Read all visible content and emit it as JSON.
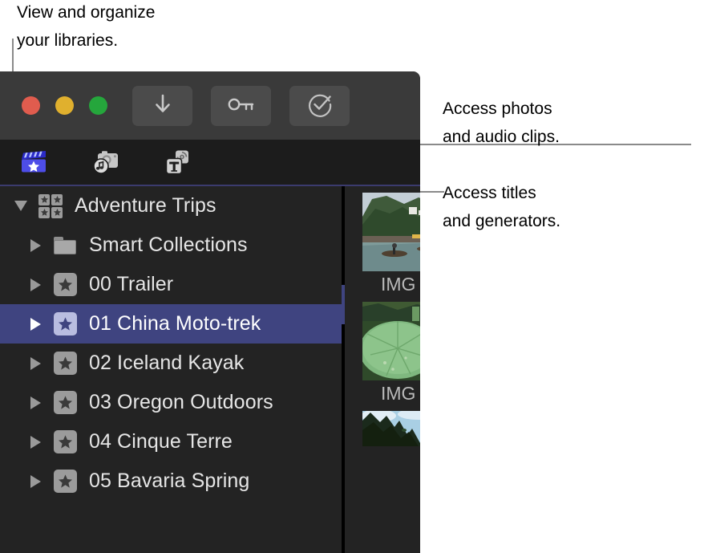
{
  "callouts": {
    "libraries": "View and organize\nyour libraries.",
    "photos": "Access photos\nand audio clips.",
    "titles": "Access titles\nand generators."
  },
  "window": {
    "traffic_lights": [
      {
        "name": "close",
        "color": "#e05c4e"
      },
      {
        "name": "minimize",
        "color": "#e0b02e"
      },
      {
        "name": "zoom",
        "color": "#25a63c"
      }
    ],
    "toolbar_buttons": [
      {
        "name": "import-media-button",
        "icon": "download-arrow-icon",
        "label": ""
      },
      {
        "name": "keyword-editor-button",
        "icon": "key-icon",
        "label": ""
      },
      {
        "name": "analyze-button",
        "icon": "checkmark-circle-icon",
        "label": ""
      }
    ],
    "colors": {
      "toolbar_bg": "#3a3a3a",
      "tabbar_bg": "#1c1c1c",
      "sidebar_bg": "#232323",
      "selection": "#3f4480",
      "tab_active_underline": "#3b3b6e",
      "clapper_blue": "#4d4de8"
    }
  },
  "tabs": [
    {
      "name": "tab-libraries",
      "icon": "film-clapper-star-icon",
      "label": "Libraries",
      "active": true
    },
    {
      "name": "tab-photos-audio",
      "icon": "camera-music-note-icon",
      "label": "Photos and Audio",
      "active": false
    },
    {
      "name": "tab-titles-generators",
      "icon": "title-generators-icon",
      "label": "Titles and Generators",
      "active": false
    }
  ],
  "sidebar": {
    "items": [
      {
        "label": "Adventure Trips",
        "icon": "library-grid-icon",
        "disclosure": "down",
        "level": 0,
        "selected": false
      },
      {
        "label": "Smart Collections",
        "icon": "folder-icon",
        "disclosure": "right",
        "level": 1,
        "selected": false
      },
      {
        "label": "00 Trailer",
        "icon": "star-event-icon",
        "disclosure": "right",
        "level": 1,
        "selected": false
      },
      {
        "label": "01 China Moto-trek",
        "icon": "star-event-icon",
        "disclosure": "right",
        "level": 1,
        "selected": true
      },
      {
        "label": "02 Iceland Kayak",
        "icon": "star-event-icon",
        "disclosure": "right",
        "level": 1,
        "selected": false
      },
      {
        "label": "03 Oregon Outdoors",
        "icon": "star-event-icon",
        "disclosure": "right",
        "level": 1,
        "selected": false
      },
      {
        "label": "04 Cinque Terre",
        "icon": "star-event-icon",
        "disclosure": "right",
        "level": 1,
        "selected": false
      },
      {
        "label": "05 Bavaria Spring",
        "icon": "star-event-icon",
        "disclosure": "right",
        "level": 1,
        "selected": false
      }
    ]
  },
  "browser": {
    "clips": [
      {
        "label": "IMG",
        "scene": "river-boats"
      },
      {
        "label": "IMG",
        "scene": "lotus-leaf-flower"
      },
      {
        "label": "",
        "scene": "karst-mountain"
      }
    ]
  }
}
